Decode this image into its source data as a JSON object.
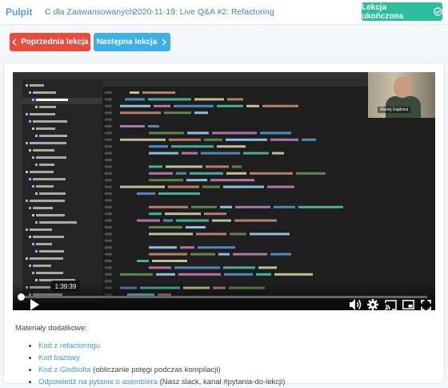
{
  "header": {
    "brand": "Pulpit",
    "breadcrumbs": [
      "C dla Zaawansowanych",
      "2020-11-19: Live Q&A #2: Refactoring"
    ],
    "complete_label": "Lekcja ukończona",
    "complete_icon": "check-circle-icon"
  },
  "nav": {
    "prev_label": "Poprzednia lekcja",
    "next_label": "Następna lekcja",
    "prev_icon": "chevron-left-icon",
    "next_icon": "chevron-right-icon"
  },
  "video": {
    "time_tooltip": "1:39:39",
    "progress": 0.0,
    "webcam_caption": "Maciej Gajdzica",
    "controls": [
      "play-icon",
      "volume-icon",
      "settings-icon",
      "cast-icon",
      "picture-in-picture-icon",
      "fullscreen-icon"
    ]
  },
  "materials": {
    "title": "Materiały dodatkowe:",
    "items": [
      {
        "link": "Kod z refactoringu",
        "note": ""
      },
      {
        "link": "Kod bazowy",
        "note": ""
      },
      {
        "link": "Kod z Godbolta",
        "note": " (obliczanie potęgi podczas kompilacji)"
      },
      {
        "link": "Odpowiedź na pytanie o asemblera",
        "note": " (Nasz slack, kanał #pytania-do-lekcji)"
      }
    ]
  },
  "colors": {
    "complete": "#2bbf9e",
    "prev": "#e74c3c",
    "next": "#3bb0e8",
    "link": "#3b9fd8"
  }
}
